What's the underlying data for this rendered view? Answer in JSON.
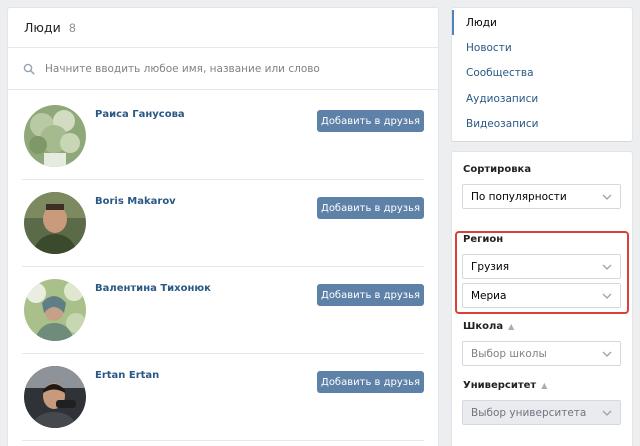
{
  "people": {
    "title": "Люди",
    "count": "8",
    "search_placeholder": "Начните вводить любое имя, название или слово",
    "add_label": "Добавить в друзья",
    "list": [
      {
        "name": "Раиса Ганусова"
      },
      {
        "name": "Boris Makarov"
      },
      {
        "name": "Валентина Тихонюк"
      },
      {
        "name": "Ertan Ertan"
      }
    ]
  },
  "nav": {
    "items": [
      {
        "label": "Люди"
      },
      {
        "label": "Новости"
      },
      {
        "label": "Сообщества"
      },
      {
        "label": "Аудиозаписи"
      },
      {
        "label": "Видеозаписи"
      }
    ]
  },
  "filters": {
    "sort_label": "Сортировка",
    "sort_value": "По популярности",
    "region_label": "Регион",
    "country_value": "Грузия",
    "city_value": "Мериа",
    "school_label": "Школа",
    "school_placeholder": "Выбор школы",
    "university_label": "Университет",
    "university_placeholder": "Выбор университета"
  },
  "colors": {
    "accent": "#5e81a8",
    "link": "#2a5885",
    "highlight": "#d9403a"
  }
}
